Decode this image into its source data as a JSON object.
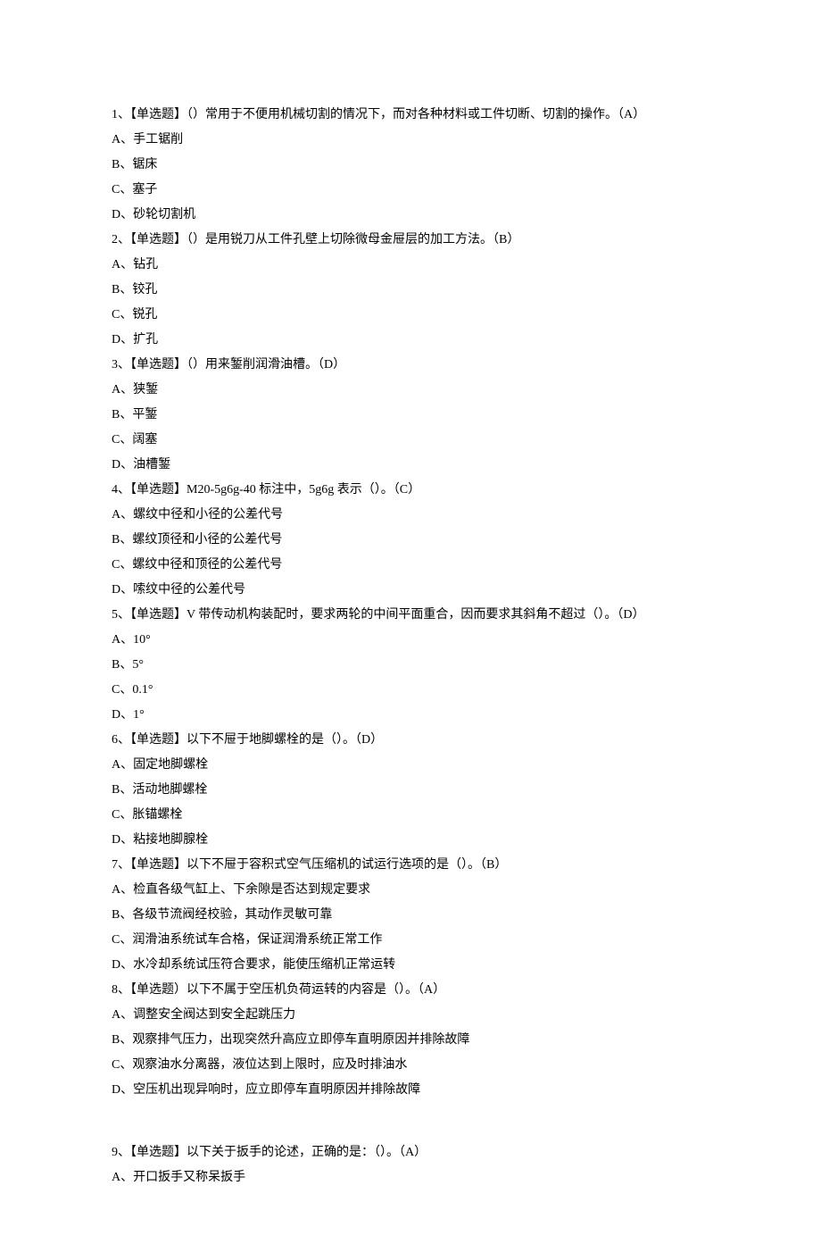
{
  "questions": [
    {
      "stem": "1、【单选题】（）常用于不便用机械切割的情况下，而对各种材料或工件切断、切割的操作。（A）",
      "options": [
        "A、手工锯削",
        "B、锯床",
        "C、塞子",
        "D、砂轮切割机"
      ]
    },
    {
      "stem": "2、【单选题】（）是用锐刀从工件孔壁上切除微母金屉层的加工方法。（B）",
      "options": [
        "A、钻孔",
        "B、铰孔",
        "C、锐孔",
        "D、扩孔"
      ]
    },
    {
      "stem": "3、【单选题】（）用来錾削润滑油槽。（D）",
      "options": [
        "A、狭錾",
        "B、平錾",
        "C、阔塞",
        "D、油槽錾"
      ]
    },
    {
      "stem": "4、【单选题】M20-5g6g-40 标注中，5g6g 表示（）。（C）",
      "options": [
        "A、螺纹中径和小径的公差代号",
        "B、螺纹顶径和小径的公差代号",
        "C、螺纹中径和顶径的公差代号",
        "D、嗦纹中径的公差代号"
      ]
    },
    {
      "stem": "5、【单选题】V 带传动机构装配时，要求两轮的中间平面重合，因而要求其斜角不超过（）。（D）",
      "options": [
        "A、10°",
        "B、5°",
        "C、0.1°",
        "D、1°"
      ]
    },
    {
      "stem": "6、【单选题】以下不屉于地脚螺栓的是（）。（D）",
      "options": [
        "A、固定地脚螺栓",
        "B、活动地脚螺栓",
        "C、胀锚螺栓",
        "D、粘接地脚腺栓"
      ]
    },
    {
      "stem": "7、【单选题】以下不屉于容积式空气压缩机的试运行选项的是（）。（B）",
      "options": [
        "A、检直各级气缸上、下余隙是否达到规定要求",
        "B、各级节流阀经校验，其动作灵敏可靠",
        "C、润滑油系统试车合格，保证润滑系统正常工作",
        "D、水冷却系统试压符合要求，能使压缩机正常运转"
      ]
    },
    {
      "stem": "8、【单选题）以下不属于空压机负荷运转的内容是（）。（A）",
      "options": [
        "A、调整安全阀达到安全起跳压力",
        "B、观察排气压力，出现突然升高应立即停车直明原因并排除故障",
        "C、观察油水分离器，液位达到上限时，应及时排油水",
        "D、空压机出现异响时，应立即停车直明原因并排除故障"
      ]
    },
    {
      "stem": "9、【单选题】以下关于扳手的论述，正确的是：（）。（A）",
      "options": [
        "A、开口扳手又称呆扳手"
      ]
    }
  ]
}
